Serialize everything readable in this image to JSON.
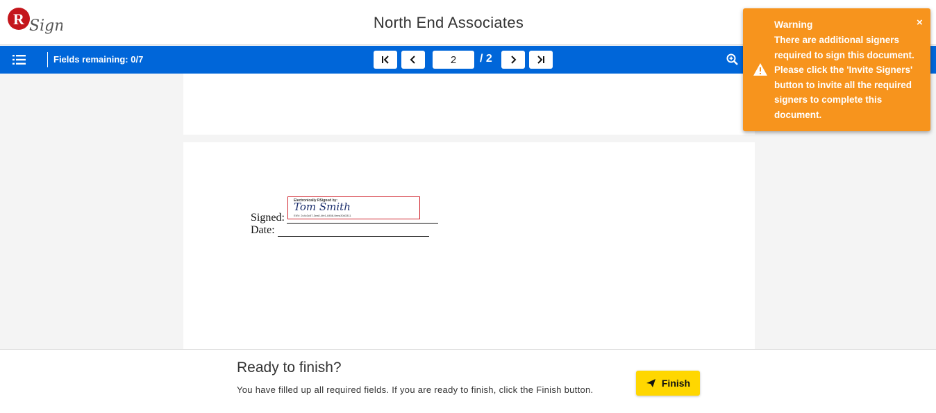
{
  "header": {
    "logo_letter": "R",
    "logo_text": "Sign",
    "company": "North End Associates"
  },
  "toolbar": {
    "fields_remaining_label": "Fields remaining:",
    "fields_remaining_value": "0/7",
    "current_page": "2",
    "total_pages": "/ 2"
  },
  "document": {
    "signed_label": "Signed:",
    "date_label": "Date:",
    "signature": {
      "title": "Electronically RSigned by:",
      "name": "Tom Smith",
      "env": "ENV: 2c4c3c57-3ea0-4fe1-8458-0eea30d3311"
    }
  },
  "footer": {
    "title": "Ready to finish?",
    "message": "You have filled up all required fields. If you are ready to finish, click the Finish button.",
    "finish_label": "Finish"
  },
  "toast": {
    "title": "Warning",
    "message": "There are additional signers required to sign this document. Please click the 'Invite Signers' button to invite all the required signers to complete this document.",
    "close": "×"
  },
  "colors": {
    "toolbar": "#0066d9",
    "warning": "#f7941d",
    "finish": "#ffd700",
    "logo_red": "#c4161c",
    "signature_border": "#d0202a"
  }
}
